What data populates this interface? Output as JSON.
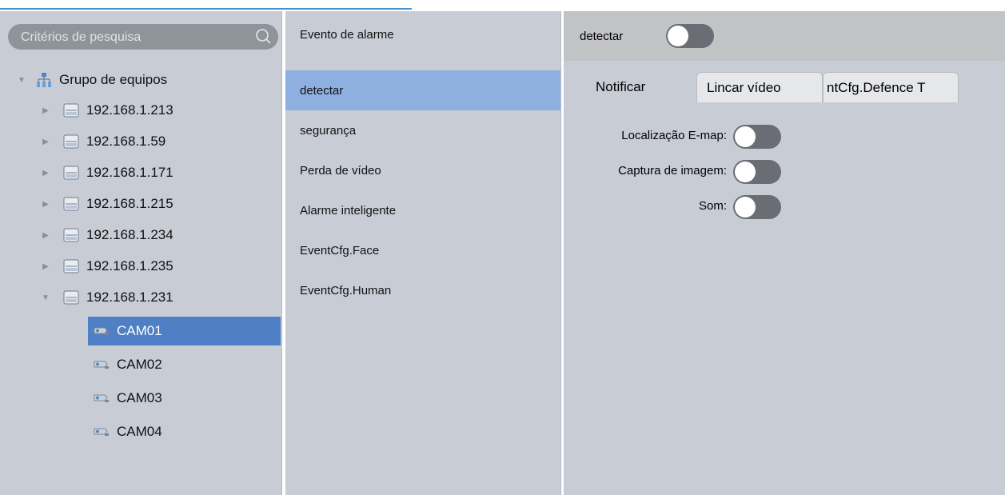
{
  "search": {
    "placeholder": "Critérios de pesquisa",
    "icon": "search-icon"
  },
  "tree": {
    "root": {
      "label": "Grupo de equipos",
      "icon": "device-group-icon",
      "expanded": true
    },
    "devices": [
      {
        "label": "192.168.1.213",
        "expanded": false
      },
      {
        "label": "192.168.1.59",
        "expanded": false
      },
      {
        "label": "192.168.1.171",
        "expanded": false
      },
      {
        "label": "192.168.1.215",
        "expanded": false
      },
      {
        "label": "192.168.1.234",
        "expanded": false
      },
      {
        "label": "192.168.1.235",
        "expanded": false
      },
      {
        "label": "192.168.1.231",
        "expanded": true
      }
    ],
    "cameras": [
      {
        "label": "CAM01",
        "selected": true
      },
      {
        "label": "CAM02",
        "selected": false
      },
      {
        "label": "CAM03",
        "selected": false
      },
      {
        "label": "CAM04",
        "selected": false
      }
    ]
  },
  "events": {
    "header": "Evento de alarme",
    "items": [
      {
        "label": "detectar",
        "selected": true
      },
      {
        "label": "segurança",
        "selected": false
      },
      {
        "label": "Perda de vídeo",
        "selected": false
      },
      {
        "label": "Alarme inteligente",
        "selected": false
      },
      {
        "label": "EventCfg.Face",
        "selected": false
      },
      {
        "label": "EventCfg.Human",
        "selected": false
      }
    ]
  },
  "config": {
    "enable_label": "detectar",
    "enable_on": false,
    "tabs": [
      {
        "label": "Notificar",
        "active": true
      },
      {
        "label": "Lincar vídeo",
        "active": false
      },
      {
        "label": "ntCfg.Defence T",
        "active": false
      }
    ],
    "fields": [
      {
        "label": "Localização E-map:",
        "on": false
      },
      {
        "label": "Captura de imagem:",
        "on": false
      },
      {
        "label": "Som:",
        "on": false
      }
    ]
  },
  "colors": {
    "panel": "#c8ccd5",
    "selected_tree": "#4f7fc4",
    "selected_event": "#8db0e0",
    "toggle_off": "#6a6e74"
  }
}
